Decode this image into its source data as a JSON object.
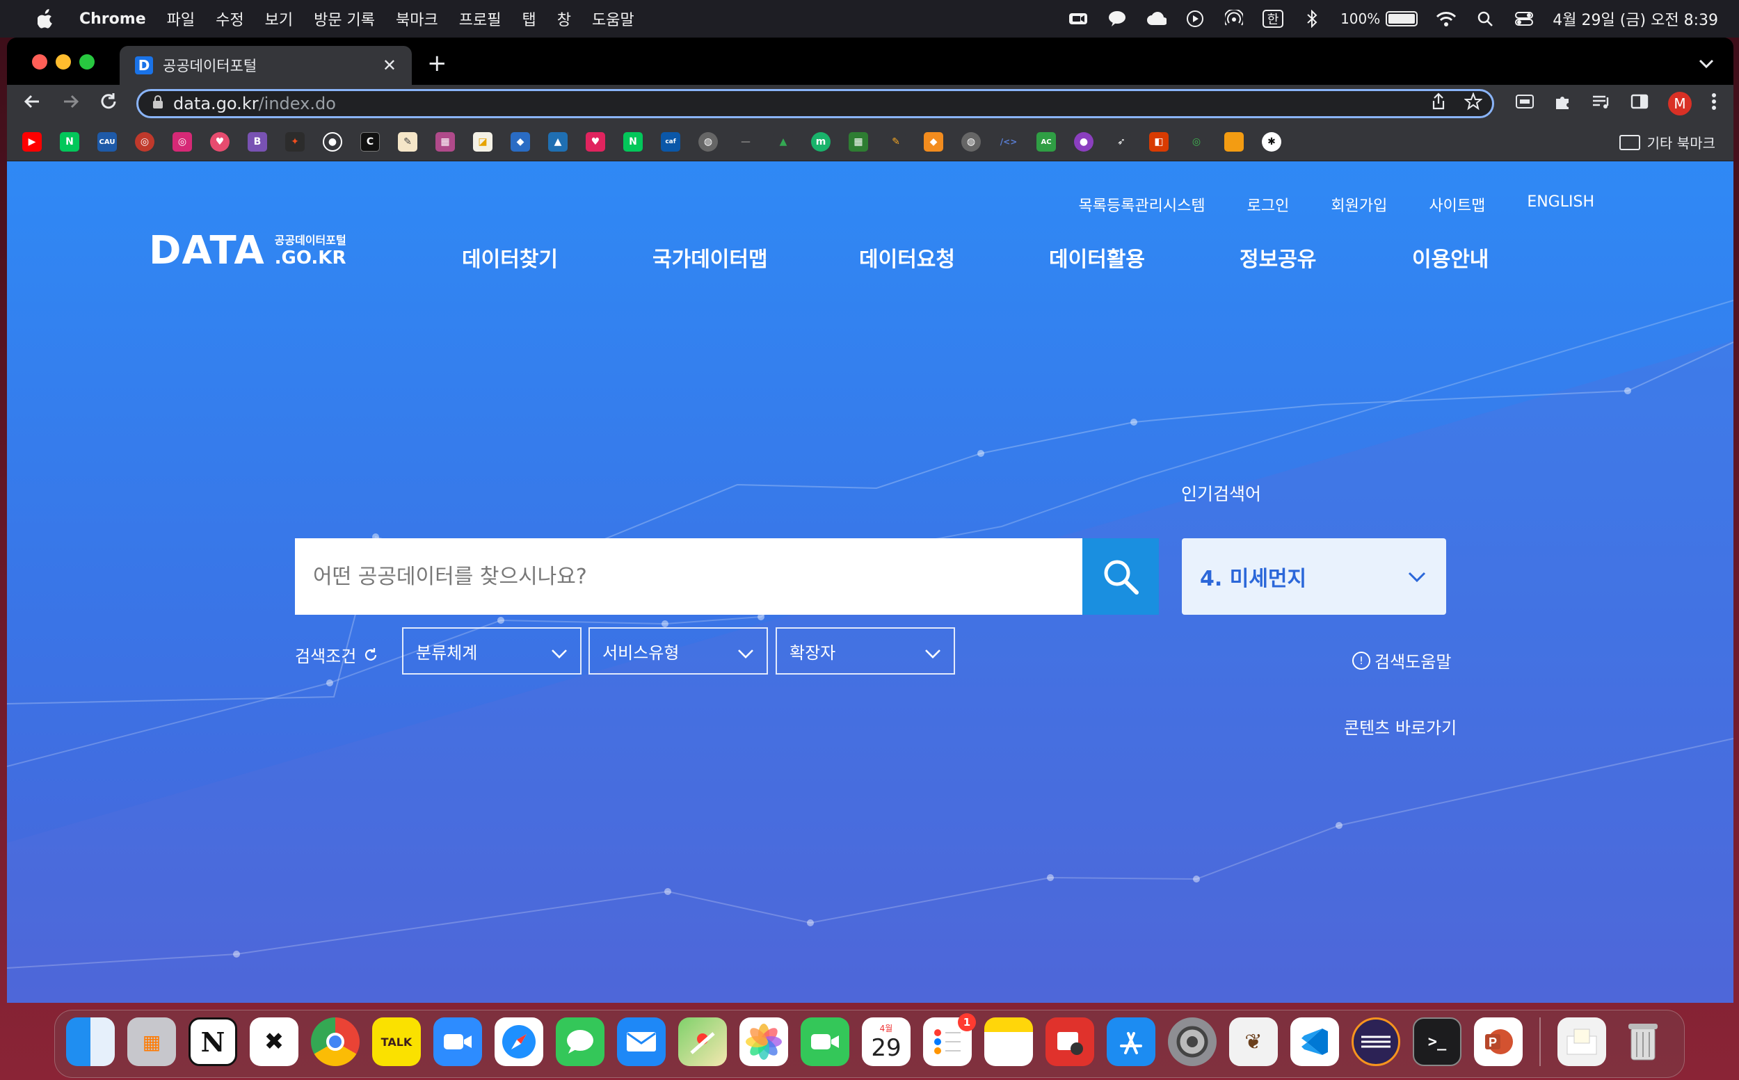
{
  "menubar": {
    "app_name": "Chrome",
    "items": [
      "파일",
      "수정",
      "보기",
      "방문 기록",
      "북마크",
      "프로필",
      "탭",
      "창",
      "도움말"
    ],
    "battery": "100%",
    "clock": "4월 29일 (금) 오전 8:39",
    "input_source": "한"
  },
  "browser": {
    "tab_title": "공공데이터포털",
    "favicon_letter": "D",
    "url_host": "data.go.kr",
    "url_path": "/index.do",
    "profile_letter": "M",
    "other_bookmarks": "기타 북마크"
  },
  "site": {
    "util_links": [
      "목록등록관리시스템",
      "로그인",
      "회원가입",
      "사이트맵",
      "ENGLISH"
    ],
    "logo_text": "DATA",
    "logo_korean": "공공데이터포털",
    "logo_domain": ".GO.KR",
    "nav": [
      "데이터찾기",
      "국가데이터맵",
      "데이터요청",
      "데이터활용",
      "정보공유",
      "이용안내"
    ],
    "search_placeholder": "어떤 공공데이터를 찾으시나요?",
    "popular_label": "인기검색어",
    "popular_current": "4. 미세먼지",
    "condition_label": "검색조건",
    "filters": [
      "분류체계",
      "서비스유형",
      "확장자"
    ],
    "help_link": "검색도움말",
    "shortcut_link": "콘텐츠 바로가기"
  },
  "dock": {
    "calendar_month": "4월",
    "calendar_day": "29",
    "reminders_badge": "1",
    "kakao_label": "TALK"
  },
  "colors": {
    "accent": "#1a8fe0",
    "hero_top": "#2f89f5",
    "hero_bottom": "#4a64d8"
  }
}
